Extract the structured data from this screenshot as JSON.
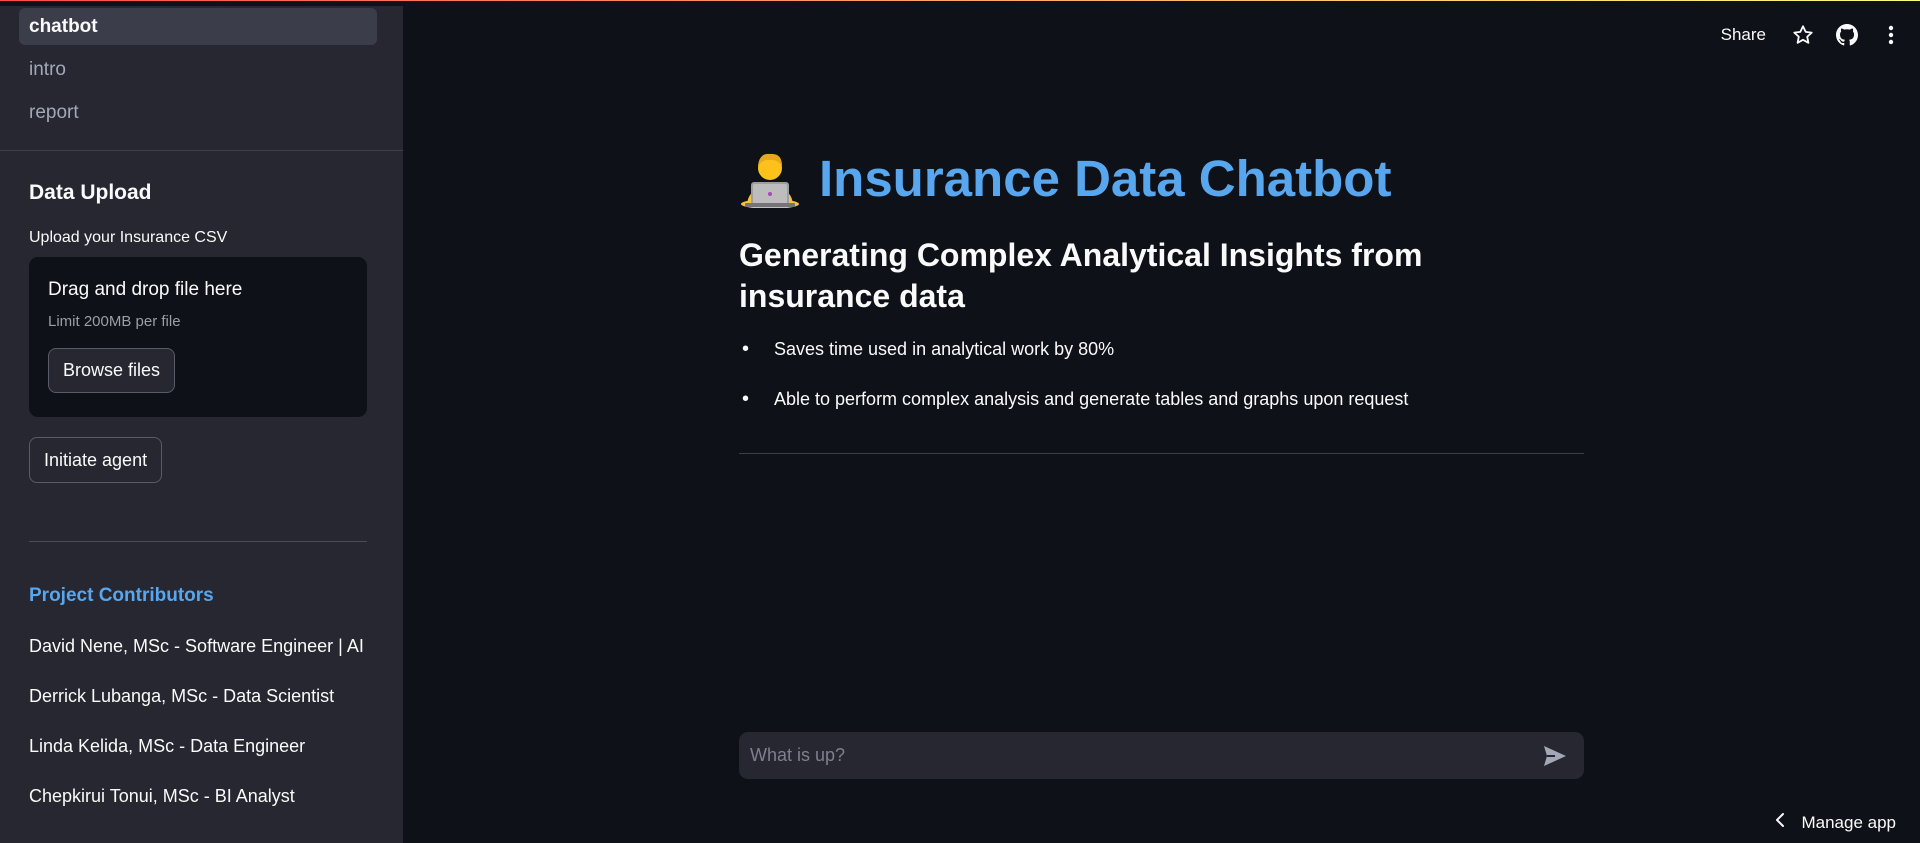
{
  "sidebar": {
    "nav": [
      {
        "label": "chatbot",
        "active": true
      },
      {
        "label": "intro",
        "active": false
      },
      {
        "label": "report",
        "active": false
      }
    ],
    "upload_heading": "Data Upload",
    "upload_label": "Upload your Insurance CSV",
    "dropzone": {
      "title": "Drag and drop file here",
      "limit": "Limit 200MB per file",
      "browse_label": "Browse files"
    },
    "initiate_label": "Initiate agent",
    "contributors_title": "Project Contributors",
    "contributors": [
      "David Nene, MSc - Software Engineer | AI",
      "Derrick Lubanga, MSc - Data Scientist",
      "Linda Kelida, MSc - Data Engineer",
      "Chepkirui Tonui, MSc - BI Analyst"
    ]
  },
  "header": {
    "share_label": "Share",
    "icons": [
      "star-icon",
      "github-icon",
      "more-vertical-icon"
    ]
  },
  "main": {
    "title_icon": "technologist-emoji",
    "title": "Insurance Data Chatbot",
    "subtitle": "Generating Complex Analytical Insights from insurance data",
    "bullets": [
      "Saves time used in analytical work by 80%",
      "Able to perform complex analysis and generate tables and graphs upon request"
    ]
  },
  "chat": {
    "placeholder": "What is up?",
    "send_icon": "send-icon"
  },
  "footer": {
    "manage_label": "Manage app",
    "manage_icon": "chevron-left-icon"
  },
  "colors": {
    "background": "#0e1117",
    "sidebar": "#262730",
    "accent": "#58a6ee"
  }
}
